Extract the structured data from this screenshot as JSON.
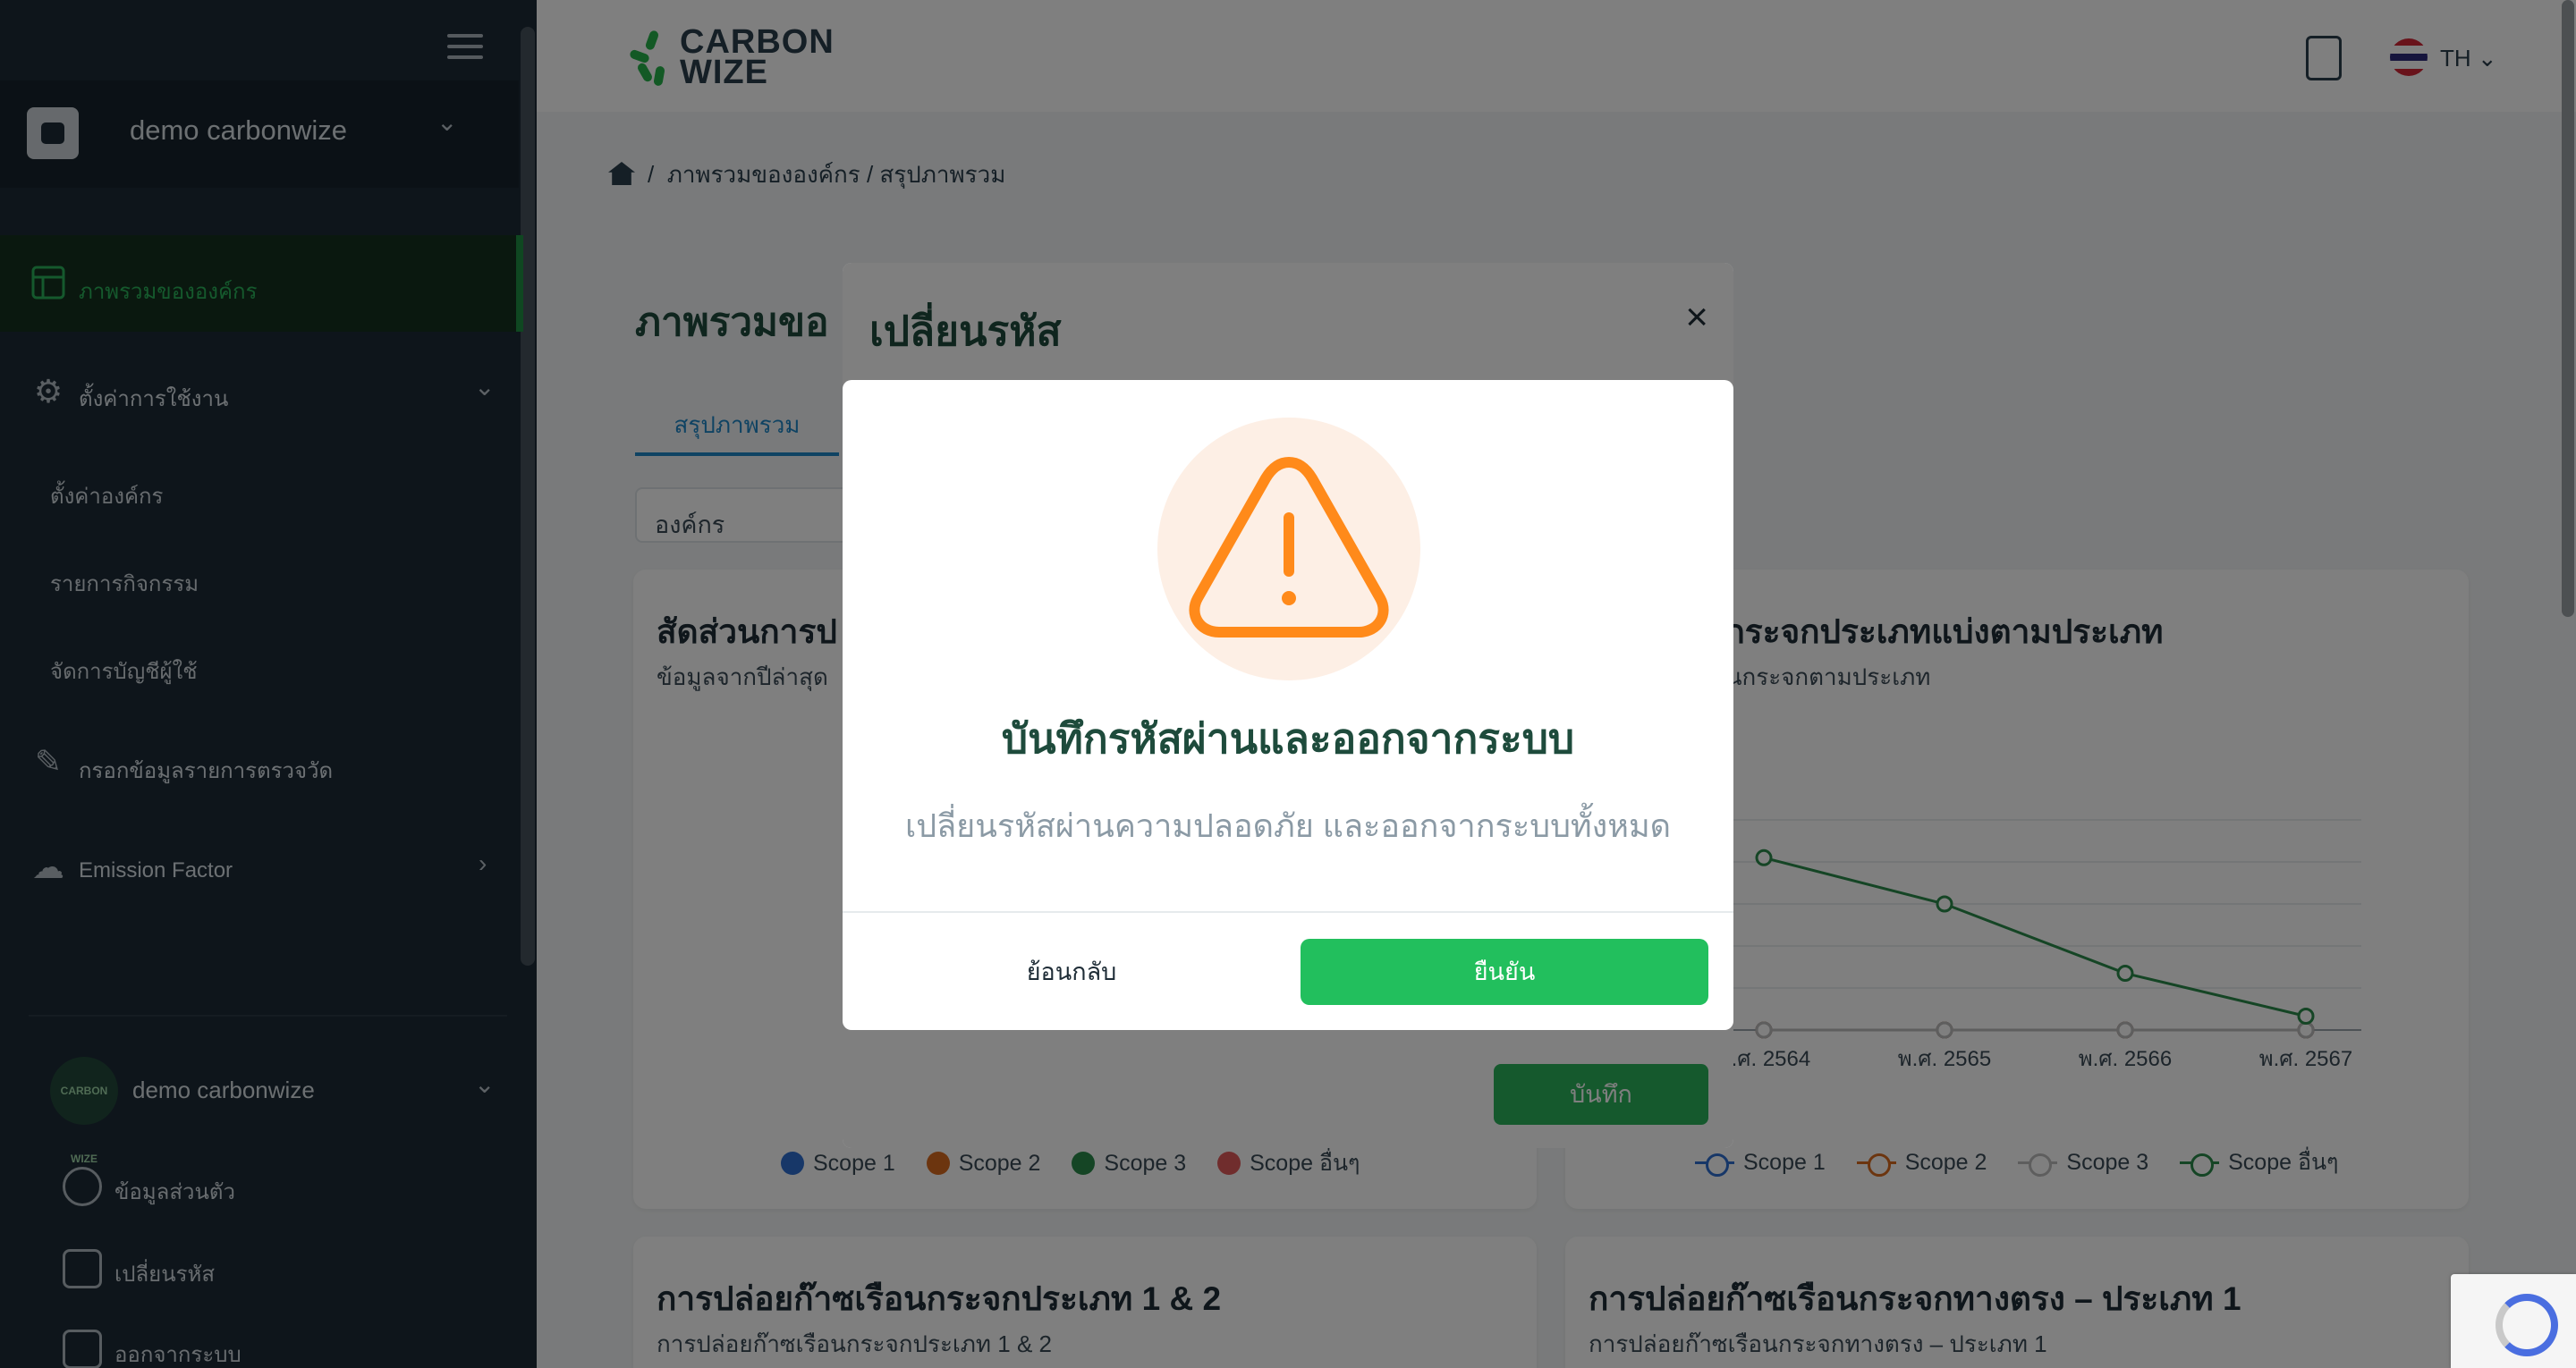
{
  "sidebar": {
    "org_name": "demo carbonwize",
    "menu": [
      {
        "label": "ภาพรวมขององค์กร",
        "icon": "layout-icon",
        "active": true
      },
      {
        "label": "ตั้งค่าการใช้งาน",
        "icon": "gear-icon"
      },
      {
        "label": "กรอกข้อมูลรายการตรวจวัด",
        "icon": "edit-icon"
      },
      {
        "label": "Emission Factor",
        "icon": "cloud-icon"
      }
    ],
    "submenu": [
      "ตั้งค่าองค์กร",
      "รายการกิจกรรม",
      "จัดการบัญชีผู้ใช้"
    ],
    "user": {
      "name": "demo carbonwize",
      "avatar_text": "CARBON WIZE",
      "items": [
        "ข้อมูลส่วนตัว",
        "เปลี่ยนรหัส",
        "ออกจากระบบ"
      ]
    }
  },
  "topbar": {
    "logo_line1": "CARBON",
    "logo_line2": "WIZE",
    "language": "TH"
  },
  "main": {
    "breadcrumb": "ภาพรวมขององค์กร / สรุปภาพรวม",
    "breadcrumb_sep": "/",
    "page_title": "ภาพรวมขอ",
    "tab": "สรุปภาพรวม",
    "filter_label": "องค์กร",
    "cards": [
      {
        "title": "สัดส่วนการป",
        "subtitle": "ข้อมูลจากปีล่าสุด"
      },
      {
        "title": "ก๊าซเรือนกระจกประเภทแบ่งตามประเภท",
        "subtitle": "ปล่อยก๊าซเรือนกระจกตามประเภท"
      },
      {
        "title": "การปล่อยก๊าซเรือนกระจกประเภท 1 & 2",
        "subtitle": "การปล่อยก๊าซเรือนกระจกประเภท 1 & 2"
      },
      {
        "title": "การปล่อยก๊าซเรือนกระจกทางตรง – ประเภท 1",
        "subtitle": "การปล่อยก๊าซเรือนกระจกทางตรง – ประเภท 1"
      }
    ],
    "pie_legend": [
      "Scope 1",
      "Scope 2",
      "Scope 3",
      "Scope อื่นๆ"
    ],
    "line_legend": [
      "Scope 1",
      "Scope 2",
      "Scope 3",
      "Scope อื่นๆ"
    ]
  },
  "chart_data": {
    "type": "line",
    "categories": [
      "พ.ศ. 2564",
      "พ.ศ. 2565",
      "พ.ศ. 2566",
      "พ.ศ. 2567"
    ],
    "series": [
      {
        "name": "Scope 1",
        "color": "#2f6fd1",
        "values": [
          0,
          0,
          0,
          0
        ]
      },
      {
        "name": "Scope 2",
        "color": "#d96a1e",
        "values": [
          0,
          0,
          0,
          0
        ]
      },
      {
        "name": "Scope 3",
        "color": "#bcbcbc",
        "values": [
          0,
          0,
          0,
          0
        ]
      },
      {
        "name": "Scope อื่นๆ",
        "color": "#2a8a4a",
        "values": [
          4.1,
          3.0,
          1.35,
          0.33
        ]
      }
    ],
    "ylim": [
      0,
      5
    ],
    "grid": true,
    "legend": "bottom"
  },
  "modal_back": {
    "title": "เปลี่ยนรหัส",
    "close": "×",
    "save_label": "บันทึก"
  },
  "dialog": {
    "icon": "warning-icon",
    "title": "บันทึกรหัสผ่านและออกจากระบบ",
    "message": "เปลี่ยนรหัสผ่านความปลอดภัย และออกจากระบบทั้งหมด",
    "back_label": "ย้อนกลับ",
    "confirm_label": "ยืนยัน"
  },
  "colors": {
    "brand_green": "#22bf5d",
    "title_green": "#1e4b3c",
    "warning_orange": "#ff8a1a",
    "link_blue": "#1f86c6"
  }
}
